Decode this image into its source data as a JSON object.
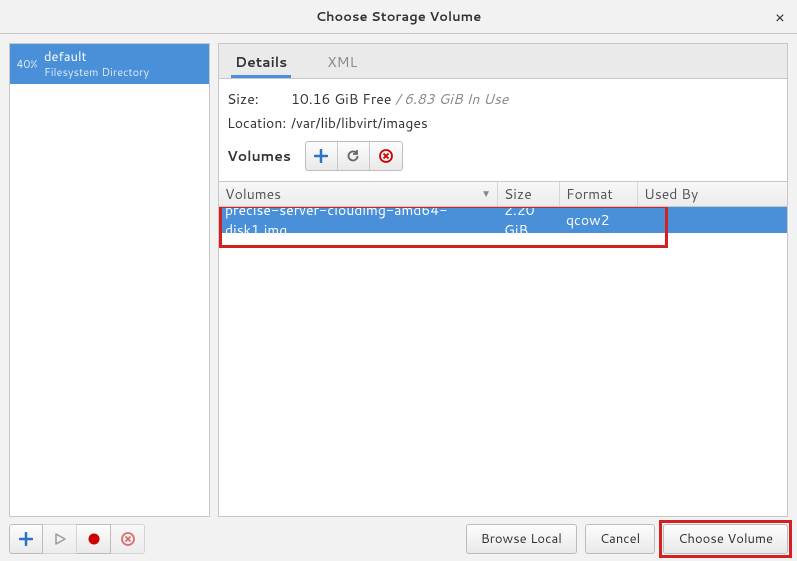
{
  "window": {
    "title": "Choose Storage Volume"
  },
  "sidebar": {
    "pool": {
      "percent": "40%",
      "name": "default",
      "type": "Filesystem Directory"
    }
  },
  "tabs": {
    "details": "Details",
    "xml": "XML"
  },
  "meta": {
    "size_label": "Size:",
    "size_free": "10.16 GiB Free",
    "size_inuse": " / 6.83 GiB In Use",
    "location_label": "Location:",
    "location_value": "/var/lib/libvirt/images"
  },
  "volumes_bar": {
    "label": "Volumes"
  },
  "columns": {
    "volumes": "Volumes",
    "size": "Size",
    "format": "Format",
    "usedby": "Used By"
  },
  "rows": [
    {
      "name": "precise-server-cloudimg-amd64-disk1.img",
      "size": "2.20 GiB",
      "format": "qcow2",
      "usedby": ""
    }
  ],
  "footer": {
    "browse": "Browse Local",
    "cancel": "Cancel",
    "choose": "Choose Volume"
  },
  "icons": {
    "add": "add-icon",
    "refresh": "refresh-icon",
    "delete": "delete-icon",
    "play": "play-icon",
    "stop": "stop-icon",
    "remove": "remove-icon"
  }
}
